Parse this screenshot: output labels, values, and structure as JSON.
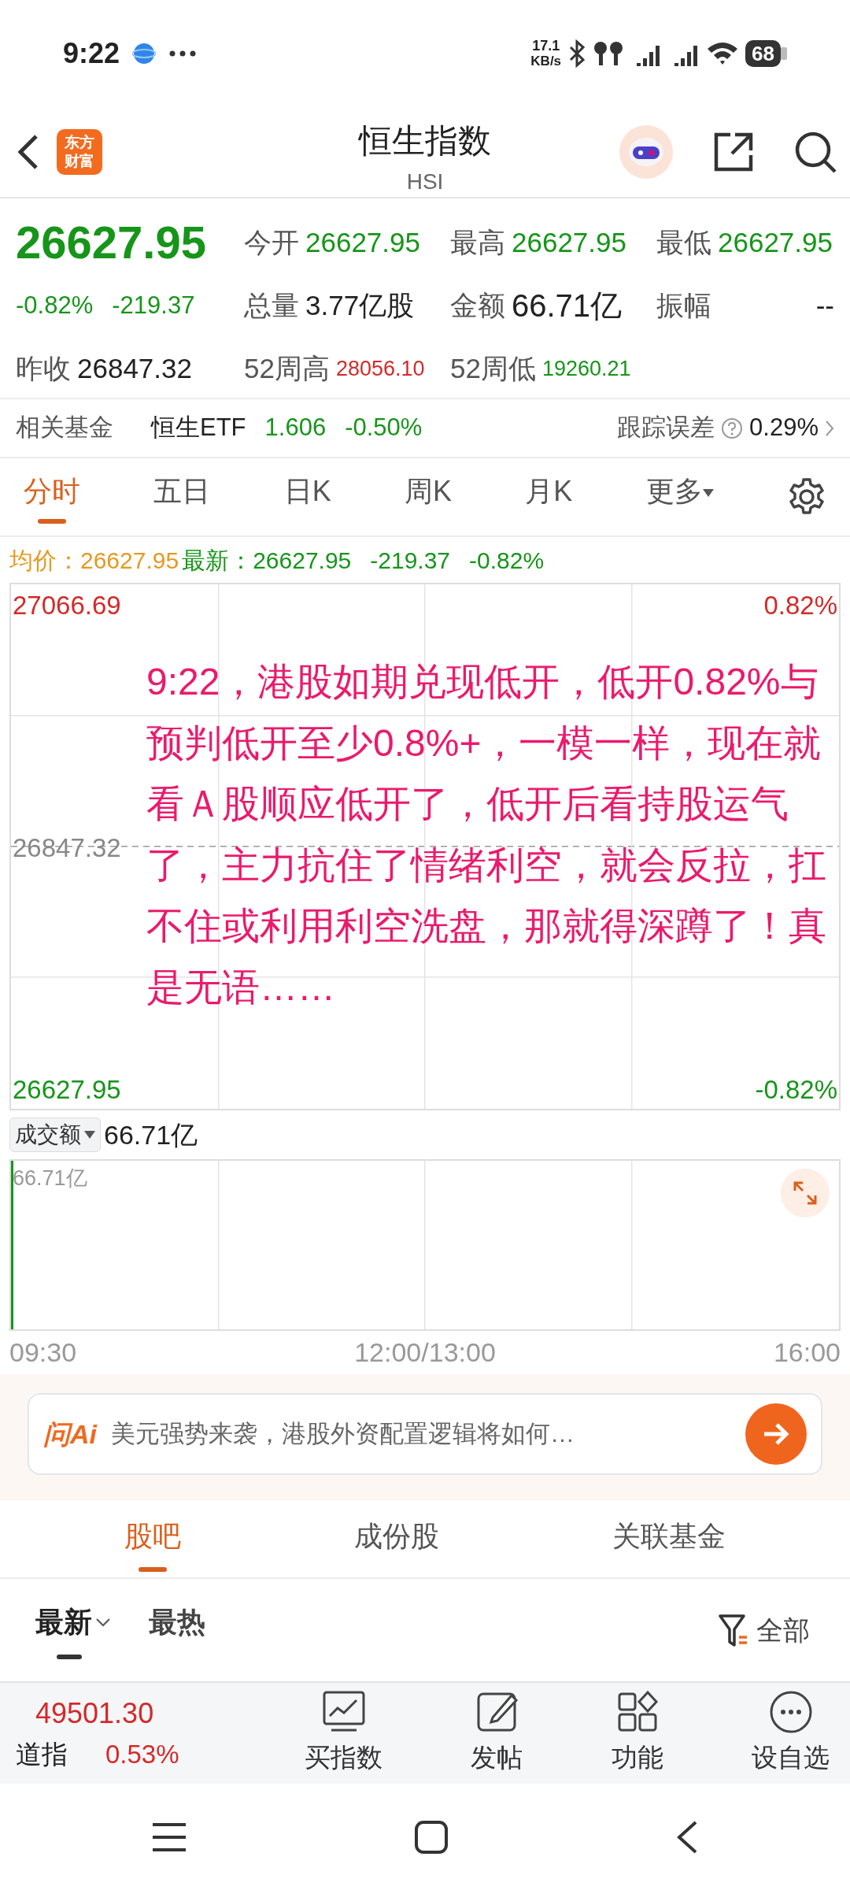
{
  "status_bar": {
    "time": "9:22",
    "net_speed": "17.1",
    "net_unit": "KB/s",
    "battery": "68"
  },
  "header": {
    "title": "恒生指数",
    "code": "HSI",
    "logo_lines": [
      "东方",
      "财富"
    ]
  },
  "quote": {
    "price": "26627.95",
    "change_pct": "-0.82%",
    "change": "-219.37",
    "color": "#17951a",
    "stats": [
      {
        "label": "今开",
        "value": "26627.95",
        "color": "#17951a"
      },
      {
        "label": "最高",
        "value": "26627.95",
        "color": "#17951a"
      },
      {
        "label": "最低",
        "value": "26627.95",
        "color": "#17951a"
      },
      {
        "label": "总量",
        "value": "3.77亿股",
        "color": "#222222"
      },
      {
        "label": "金额",
        "value": "66.71亿",
        "color": "#222222"
      },
      {
        "label": "振幅",
        "value": "--",
        "color": "#222222"
      },
      {
        "label": "昨收",
        "value": "26847.32",
        "color": "#222222"
      },
      {
        "label": "52周高",
        "value": "28056.10",
        "color": "#d32a2a"
      },
      {
        "label": "52周低",
        "value": "19260.21",
        "color": "#17951a"
      }
    ]
  },
  "related_fund": {
    "label": "相关基金",
    "name": "恒生ETF",
    "price": "1.606",
    "change": "-0.50%",
    "tracking_label": "跟踪误差",
    "tracking_value": "0.29%"
  },
  "chart_tabs": [
    {
      "label": "分时",
      "selected": true
    },
    {
      "label": "五日",
      "selected": false
    },
    {
      "label": "日K",
      "selected": false
    },
    {
      "label": "周K",
      "selected": false
    },
    {
      "label": "月K",
      "selected": false
    },
    {
      "label": "更多",
      "selected": false
    }
  ],
  "legend": {
    "avg_label": "均价：",
    "avg_value": "26627.95",
    "last_label": "最新：",
    "last_value": "26627.95",
    "change": "-219.37",
    "change_pct": "-0.82%"
  },
  "price_chart": {
    "top_price": "27066.69",
    "top_pct": "0.82%",
    "mid_price": "26847.32",
    "bottom_price": "26627.95",
    "bottom_pct": "-0.82%"
  },
  "annotation": "9:22，港股如期兑现低开，低开0.82%与预判低开至少0.8%+，一模一样，现在就看Ａ股顺应低开了，低开后看持股运气了，主力抗住了情绪利空，就会反拉，扛不住或利用利空洗盘，那就得深蹲了！真是无语……",
  "volume": {
    "selector": "成交额",
    "value": "66.71亿",
    "axis_label": "66.71亿"
  },
  "time_axis": [
    "09:30",
    "12:00/13:00",
    "16:00"
  ],
  "ai_bar": {
    "logo": "问Ai",
    "placeholder": "美元强势来袭，港股外资配置逻辑将如何…"
  },
  "section_tabs": [
    {
      "label": "股吧",
      "selected": true
    },
    {
      "label": "成份股",
      "selected": false
    },
    {
      "label": "关联基金",
      "selected": false
    }
  ],
  "sort_tabs": [
    {
      "label": "最新",
      "selected": true
    },
    {
      "label": "最热",
      "selected": false
    }
  ],
  "filter": "全部",
  "bottom_bar": {
    "ticker_value": "49501.30",
    "ticker_name": "道指",
    "ticker_change": "0.53%",
    "actions": [
      {
        "kind": "chart",
        "label": "买指数"
      },
      {
        "kind": "edit",
        "label": "发帖"
      },
      {
        "kind": "grid",
        "label": "功能"
      },
      {
        "kind": "more",
        "label": "设自选"
      }
    ]
  }
}
